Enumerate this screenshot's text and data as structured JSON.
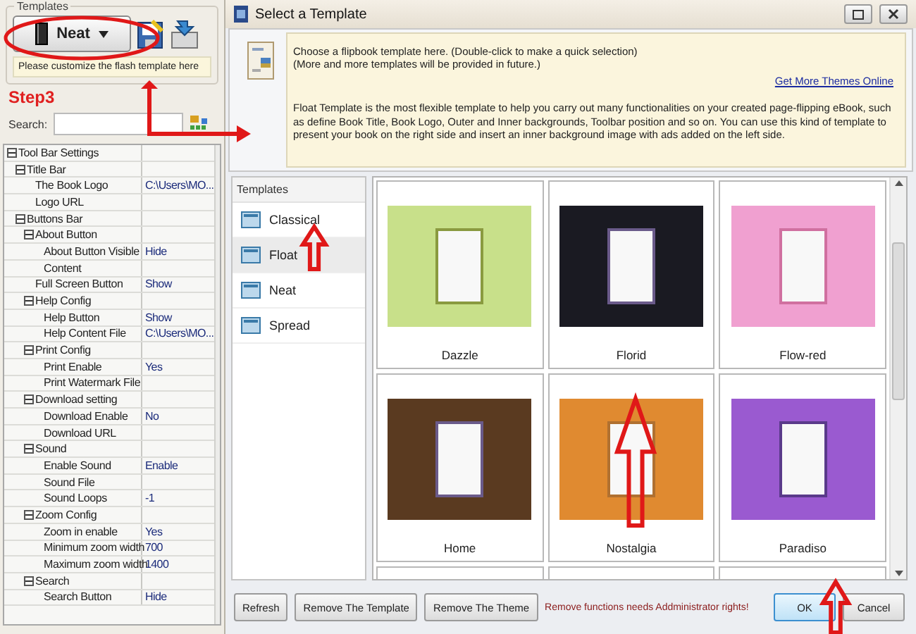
{
  "left_panel": {
    "group_label": "Templates",
    "template_button": {
      "label": "Neat"
    },
    "tip": "Please customize the flash template here",
    "step_label": "Step3",
    "search": {
      "label": "Search:"
    },
    "settings_tree": [
      {
        "label": "Tool Bar Settings",
        "expanded": true,
        "children": [
          {
            "label": "Title Bar",
            "expanded": true,
            "children": [
              {
                "label": "The Book Logo",
                "value": "C:\\Users\\MO..."
              },
              {
                "label": "Logo URL"
              }
            ]
          },
          {
            "label": "Buttons Bar",
            "expanded": true,
            "children": [
              {
                "label": "About Button",
                "expanded": true,
                "children": [
                  {
                    "label": "About Button Visible",
                    "value": "Hide"
                  },
                  {
                    "label": "Content"
                  }
                ]
              },
              {
                "label": "Full Screen Button",
                "value": "Show"
              },
              {
                "label": "Help Config",
                "expanded": true,
                "children": [
                  {
                    "label": "Help Button",
                    "value": "Show"
                  },
                  {
                    "label": "Help Content File",
                    "value": "C:\\Users\\MO..."
                  }
                ]
              },
              {
                "label": "Print Config",
                "expanded": true,
                "children": [
                  {
                    "label": "Print Enable",
                    "value": "Yes"
                  },
                  {
                    "label": "Print Watermark File"
                  }
                ]
              },
              {
                "label": "Download setting",
                "expanded": true,
                "children": [
                  {
                    "label": "Download Enable",
                    "value": "No"
                  },
                  {
                    "label": "Download URL"
                  }
                ]
              },
              {
                "label": "Sound",
                "expanded": true,
                "children": [
                  {
                    "label": "Enable Sound",
                    "value": "Enable"
                  },
                  {
                    "label": "Sound File"
                  },
                  {
                    "label": "Sound Loops",
                    "value": "-1"
                  }
                ]
              },
              {
                "label": "Zoom Config",
                "expanded": true,
                "children": [
                  {
                    "label": "Zoom in enable",
                    "value": "Yes"
                  },
                  {
                    "label": "Minimum zoom width",
                    "value": "700"
                  },
                  {
                    "label": "Maximum zoom width",
                    "value": "1400"
                  }
                ]
              },
              {
                "label": "Search",
                "expanded": true,
                "children": [
                  {
                    "label": "Search Button",
                    "value": "Hide"
                  }
                ]
              }
            ]
          }
        ]
      }
    ]
  },
  "dialog": {
    "title": "Select a Template",
    "info": {
      "lines": [
        "Choose a flipbook template here. (Double-click to make a quick selection)",
        "(More and more templates will be provided in future.)"
      ],
      "link": "Get More Themes Online",
      "description": "Float Template is the most flexible template to help you carry out many functionalities on your created page-flipping eBook, such as define Book Title, Book Logo, Outer and Inner backgrounds, Toolbar position and so on. You can use this kind of template to present your book on the right side and insert an inner background image with ads added on the left side."
    },
    "template_list": {
      "header": "Templates",
      "items": [
        {
          "label": "Classical",
          "selected": false
        },
        {
          "label": "Float",
          "selected": true
        },
        {
          "label": "Neat",
          "selected": false
        },
        {
          "label": "Spread",
          "selected": false
        }
      ]
    },
    "themes": [
      {
        "name": "Dazzle"
      },
      {
        "name": "Florid"
      },
      {
        "name": "Flow-red"
      },
      {
        "name": "Home"
      },
      {
        "name": "Nostalgia"
      },
      {
        "name": "Paradiso"
      }
    ],
    "left_buttons": [
      "Refresh",
      "Remove The Template",
      "Remove The Theme"
    ],
    "notice": "Remove functions needs Addministrator rights!",
    "right_buttons": [
      {
        "label": "OK",
        "default": true
      },
      {
        "label": "Cancel",
        "default": false
      }
    ]
  }
}
